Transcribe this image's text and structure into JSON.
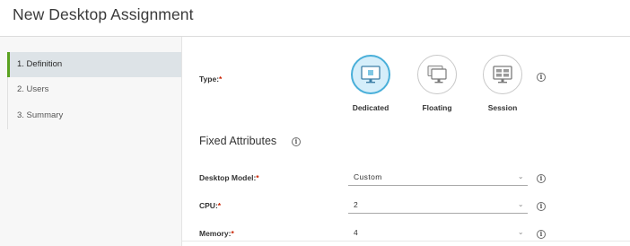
{
  "page": {
    "title": "New Desktop Assignment"
  },
  "sidebar": {
    "steps": [
      {
        "label": "1. Definition",
        "active": true
      },
      {
        "label": "2. Users",
        "active": false
      },
      {
        "label": "3. Summary",
        "active": false
      }
    ]
  },
  "type": {
    "label": "Type:",
    "required_mark": "*",
    "options": [
      {
        "label": "Dedicated",
        "icon": "monitor-icon",
        "selected": true
      },
      {
        "label": "Floating",
        "icon": "stacked-monitors-icon",
        "selected": false
      },
      {
        "label": "Session",
        "icon": "session-monitor-icon",
        "selected": false
      }
    ],
    "info_icon": "info-icon"
  },
  "fixed_attributes": {
    "title": "Fixed Attributes",
    "info_icon": "info-icon"
  },
  "fields": {
    "desktop_model": {
      "label": "Desktop Model:",
      "required_mark": "*",
      "value": "Custom"
    },
    "cpu": {
      "label": "CPU:",
      "required_mark": "*",
      "value": "2"
    },
    "memory": {
      "label": "Memory:",
      "required_mark": "*",
      "value": "4"
    }
  },
  "colors": {
    "accent": "#49afd9",
    "selected_fill": "#d5eefa",
    "active_step_bar": "#5aa220",
    "required": "#c92100"
  },
  "icons": {
    "dropdown": "chevron-down-icon",
    "info": "info-icon"
  }
}
